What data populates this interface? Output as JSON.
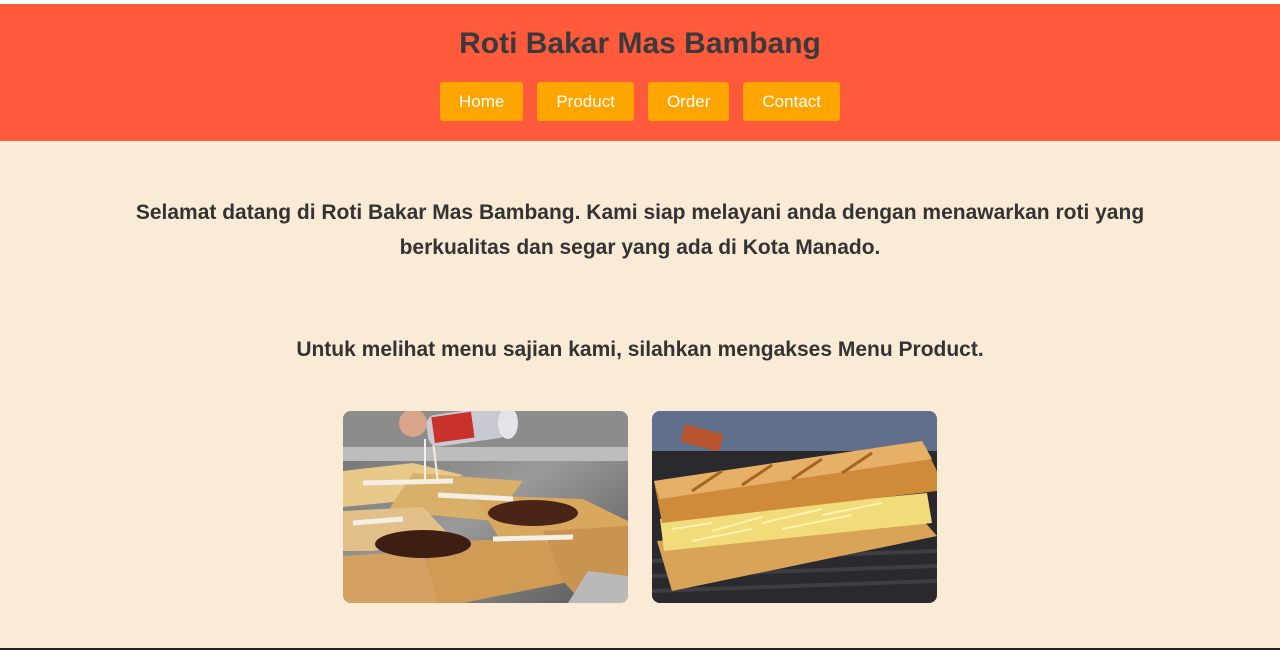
{
  "header": {
    "title": "Roti Bakar Mas Bambang",
    "nav": [
      {
        "label": "Home"
      },
      {
        "label": "Product"
      },
      {
        "label": "Order"
      },
      {
        "label": "Contact"
      }
    ]
  },
  "main": {
    "intro": "Selamat datang di Roti Bakar Mas Bambang. Kami siap melayani anda dengan menawarkan roti yang berkualitas dan segar yang ada di Kota Manado.",
    "cta": "Untuk melihat menu sajian kami, silahkan mengakses Menu Product."
  },
  "colors": {
    "header_bg": "#ff5a3c",
    "nav_button": "#ffa500",
    "page_bg": "#faebd7"
  }
}
